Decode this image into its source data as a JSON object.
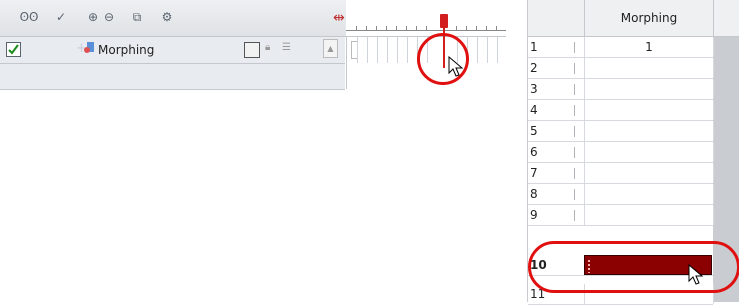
{
  "timeline": {
    "tools": [
      {
        "name": "onion-skin-icon",
        "glyph": "ʘʘ"
      },
      {
        "name": "enable-icon",
        "glyph": "✓"
      },
      {
        "name": "add-drawing-layer-icon",
        "glyph": "⊕"
      },
      {
        "name": "remove-layer-icon",
        "glyph": "⊖"
      },
      {
        "name": "add-peg-icon",
        "glyph": "⧉"
      },
      {
        "name": "layer-properties-icon",
        "glyph": "⚙"
      }
    ],
    "layer": {
      "name": "Morphing",
      "checked": true
    }
  },
  "xsheet": {
    "column_header": "Morphing",
    "rows": [
      {
        "num": "1",
        "value": "1"
      },
      {
        "num": "2",
        "value": ""
      },
      {
        "num": "3",
        "value": ""
      },
      {
        "num": "4",
        "value": ""
      },
      {
        "num": "5",
        "value": ""
      },
      {
        "num": "6",
        "value": ""
      },
      {
        "num": "7",
        "value": ""
      },
      {
        "num": "8",
        "value": ""
      },
      {
        "num": "9",
        "value": ""
      },
      {
        "num": "10",
        "value": "",
        "selected": true
      },
      {
        "num": "11",
        "value": ""
      }
    ]
  },
  "colors": {
    "highlight_circle": "#e01010",
    "selected_cell": "#8b0000",
    "playhead": "#d21e1e"
  }
}
